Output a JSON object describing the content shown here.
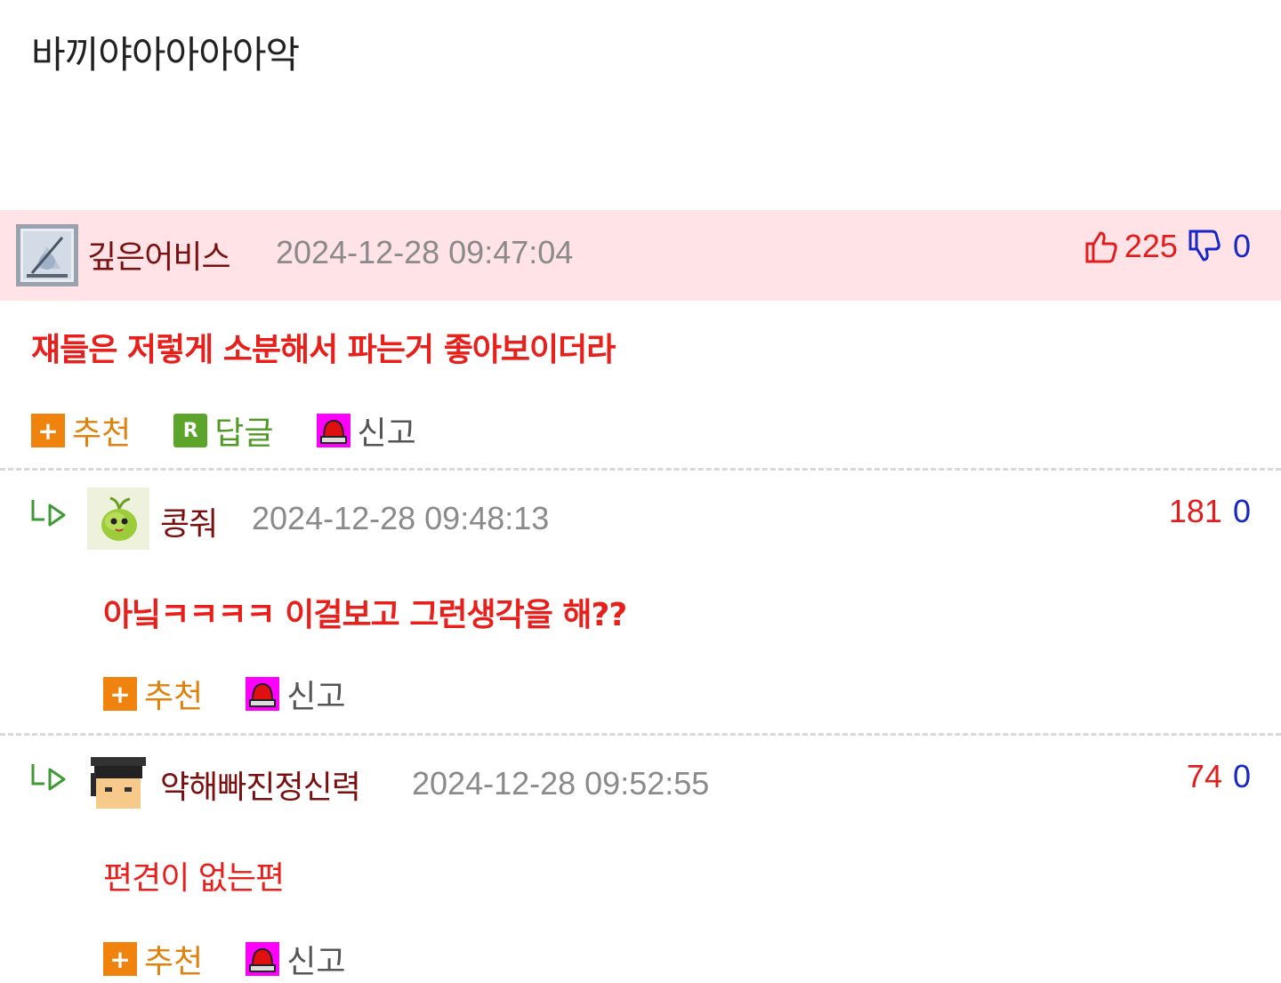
{
  "post": {
    "title": "바끼야아아아아악"
  },
  "comments": [
    {
      "nickname": "깊은어비스",
      "timestamp": "2024-12-28 09:47:04",
      "upvotes": "225",
      "downvotes": "0",
      "text": "쟤들은 저렇게 소분해서 파는거 좋아보이더라",
      "actions": {
        "recommend": "추천",
        "reply": "답글",
        "report": "신고"
      }
    },
    {
      "nickname": "콩줘",
      "timestamp": "2024-12-28 09:48:13",
      "upvotes": "181",
      "downvotes": "0",
      "text": "아닠ㅋㅋㅋㅋ 이걸보고 그런생각을 해??",
      "actions": {
        "recommend": "추천",
        "report": "신고"
      }
    },
    {
      "nickname": "약해빠진정신력",
      "timestamp": "2024-12-28 09:52:55",
      "upvotes": "74",
      "downvotes": "0",
      "text": "편견이 없는편",
      "actions": {
        "recommend": "추천",
        "report": "신고"
      }
    }
  ],
  "colors": {
    "best_background": "#ffe3e6",
    "nickname": "#7a0f0f",
    "comment_text": "#e8201c",
    "upvote": "#e31d1d",
    "downvote": "#1627c8"
  },
  "icons": {
    "upvote": "thumbs-up-icon",
    "downvote": "thumbs-down-icon",
    "recommend": "plus-icon",
    "reply": "reply-r-icon",
    "report": "siren-icon",
    "reply_indent": "reply-arrow-icon"
  }
}
